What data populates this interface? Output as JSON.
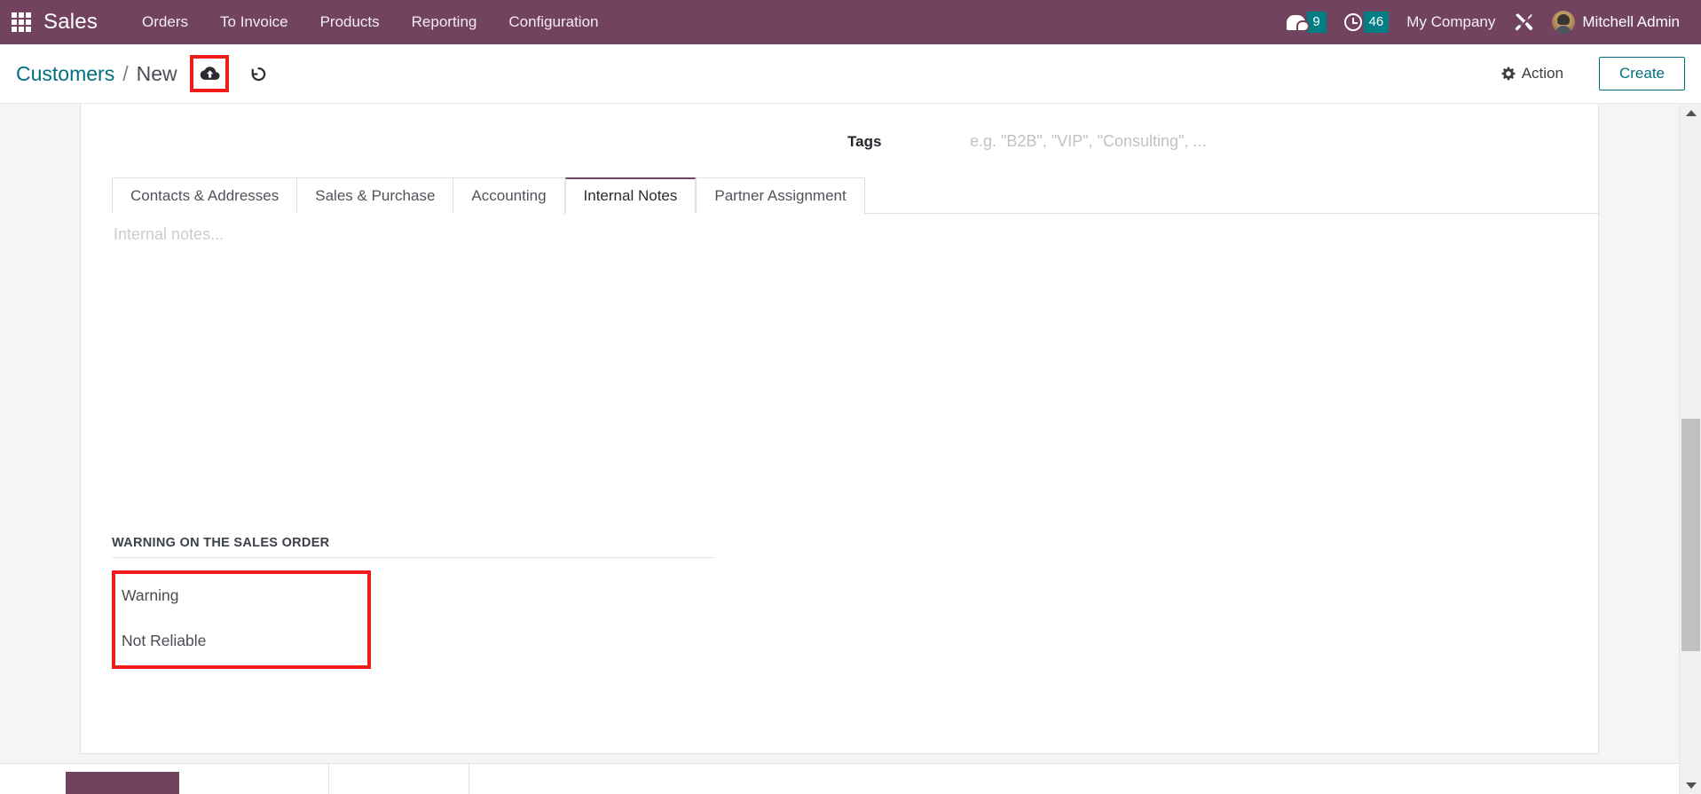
{
  "navbar": {
    "apps_icon": "grid-apps-icon",
    "brand": "Sales",
    "menu": [
      {
        "label": "Orders"
      },
      {
        "label": "To Invoice"
      },
      {
        "label": "Products"
      },
      {
        "label": "Reporting"
      },
      {
        "label": "Configuration"
      }
    ],
    "systray": {
      "messages_icon": "chat-bubble-icon",
      "messages_count": "9",
      "activities_icon": "clock-icon",
      "activities_count": "46",
      "company": "My Company",
      "debug_icon": "tools-icon",
      "avatar": "user-avatar",
      "user": "Mitchell Admin"
    },
    "accent_color": "#71435f",
    "badge_color": "#017e84"
  },
  "control_panel": {
    "breadcrumb": {
      "parent": "Customers",
      "separator": "/",
      "current": "New"
    },
    "save_icon": "cloud-upload-save-icon",
    "discard_icon": "undo-discard-icon",
    "action_label": "Action",
    "action_icon": "gear-icon",
    "create_label": "Create",
    "link_color": "#00707f"
  },
  "form": {
    "tags": {
      "label": "Tags",
      "value": "",
      "placeholder": "e.g. \"B2B\", \"VIP\", \"Consulting\", ..."
    },
    "tabs": [
      {
        "label": "Contacts & Addresses",
        "active": false
      },
      {
        "label": "Sales & Purchase",
        "active": false
      },
      {
        "label": "Accounting",
        "active": false
      },
      {
        "label": "Internal Notes",
        "active": true
      },
      {
        "label": "Partner Assignment",
        "active": false
      }
    ],
    "internal_notes": {
      "value": "",
      "placeholder": "Internal notes..."
    },
    "warning_group": {
      "title": "WARNING ON THE SALES ORDER",
      "options": [
        {
          "label": "Warning"
        },
        {
          "label": "Not Reliable"
        }
      ],
      "highlight_color": "#f01c1c"
    }
  },
  "scrollbar": {
    "up_arrow": "scroll-up-arrow",
    "down_arrow": "scroll-down-arrow"
  }
}
